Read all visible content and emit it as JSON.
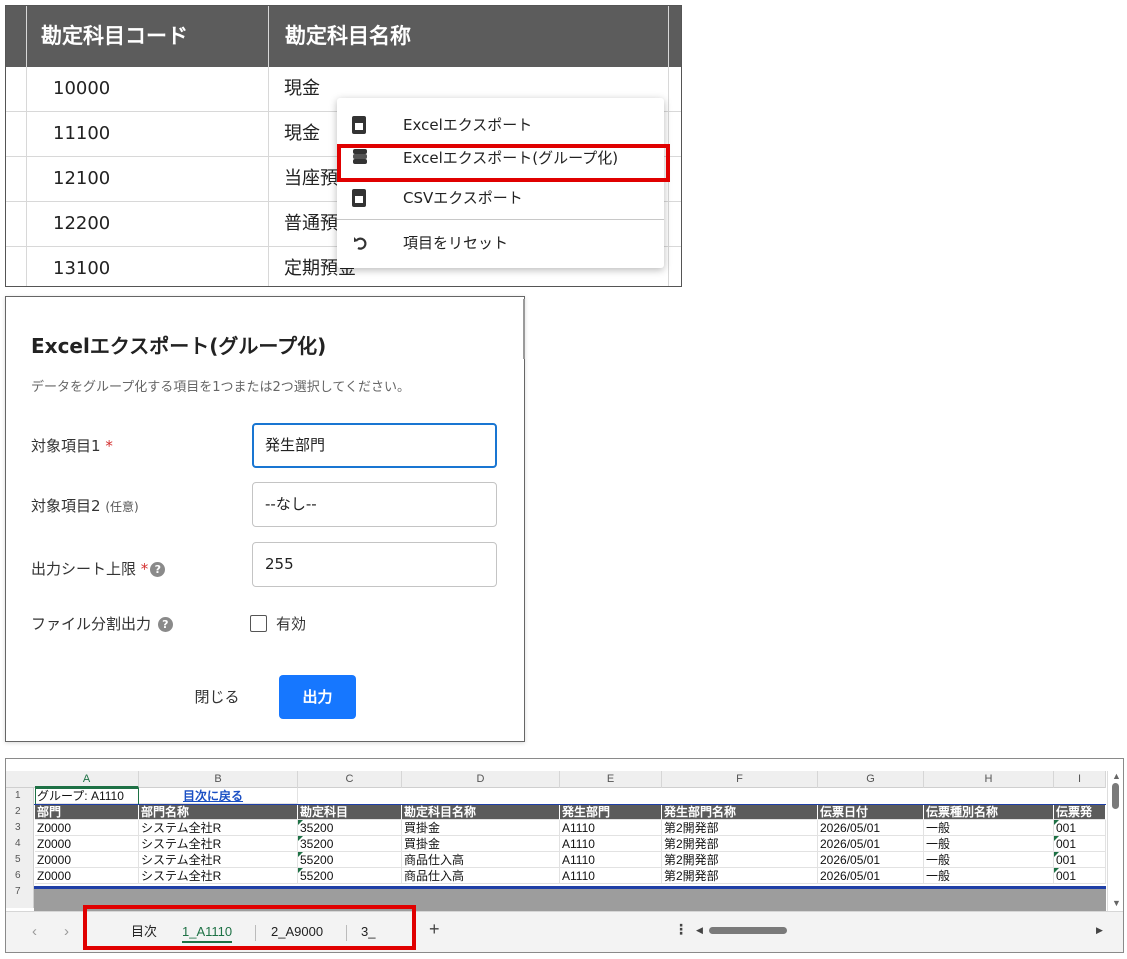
{
  "table_panel": {
    "headers": [
      "勘定科目コード",
      "勘定科目名称"
    ],
    "rows": [
      {
        "code": "10000",
        "name": "現金"
      },
      {
        "code": "11100",
        "name": "現金"
      },
      {
        "code": "12100",
        "name": "当座預"
      },
      {
        "code": "12200",
        "name": "普通預"
      },
      {
        "code": "13100",
        "name": "定期預金"
      }
    ],
    "context_menu": [
      {
        "label": "Excelエクスポート",
        "icon": "excel-file-icon"
      },
      {
        "label": "Excelエクスポート(グループ化)",
        "icon": "layers-icon"
      },
      {
        "label": "CSVエクスポート",
        "icon": "csv-file-icon"
      },
      {
        "label": "項目をリセット",
        "icon": "reset-icon"
      }
    ]
  },
  "dialog": {
    "title": "Excelエクスポート(グループ化)",
    "description": "データをグループ化する項目を1つまたは2つ選択してください。",
    "field1": {
      "label": "対象項目1",
      "required_mark": "*",
      "value": "発生部門"
    },
    "field2": {
      "label": "対象項目2",
      "optional_note": "(任意)",
      "value": "--なし--"
    },
    "field3": {
      "label": "出力シート上限",
      "required_mark": "*",
      "help": "?",
      "value": "255"
    },
    "field4": {
      "label": "ファイル分割出力",
      "help": "?",
      "checkbox_label": "有効",
      "checked": false
    },
    "close_label": "閉じる",
    "output_label": "出力",
    "colors": {
      "primary": "#1677ff",
      "required": "#d32f2f",
      "focus": "#1976d2"
    }
  },
  "sheet": {
    "col_letters": [
      "A",
      "B",
      "C",
      "D",
      "E",
      "F",
      "G",
      "H",
      "I"
    ],
    "row_numbers": [
      "1",
      "2",
      "3",
      "4",
      "5",
      "6",
      "7"
    ],
    "group_label": "グループ: A1110",
    "back_link": "目次に戻る",
    "headers": [
      "部門",
      "部門名称",
      "勘定科目",
      "勘定科目名称",
      "発生部門",
      "発生部門名称",
      "伝票日付",
      "伝票種別名称",
      "伝票発"
    ],
    "rows": [
      [
        "Z0000",
        "システム全社R",
        "35200",
        "買掛金",
        "A1110",
        "第2開発部",
        "2026/05/01",
        "一般",
        "001"
      ],
      [
        "Z0000",
        "システム全社R",
        "35200",
        "買掛金",
        "A1110",
        "第2開発部",
        "2026/05/01",
        "一般",
        "001"
      ],
      [
        "Z0000",
        "システム全社R",
        "55200",
        "商品仕入高",
        "A1110",
        "第2開発部",
        "2026/05/01",
        "一般",
        "001"
      ],
      [
        "Z0000",
        "システム全社R",
        "55200",
        "商品仕入高",
        "A1110",
        "第2開発部",
        "2026/05/01",
        "一般",
        "001"
      ]
    ],
    "tabs": [
      "目次",
      "1_A1110",
      "2_A9000",
      "3_"
    ],
    "active_tab": "1_A1110",
    "add_label": "+",
    "options_label": "⋮",
    "colors": {
      "header_bg": "#5b5b5b",
      "accent": "#1e7145",
      "link": "#1a4fc4",
      "border_line": "#1f3fa6"
    }
  },
  "highlight_color": "#e00000"
}
